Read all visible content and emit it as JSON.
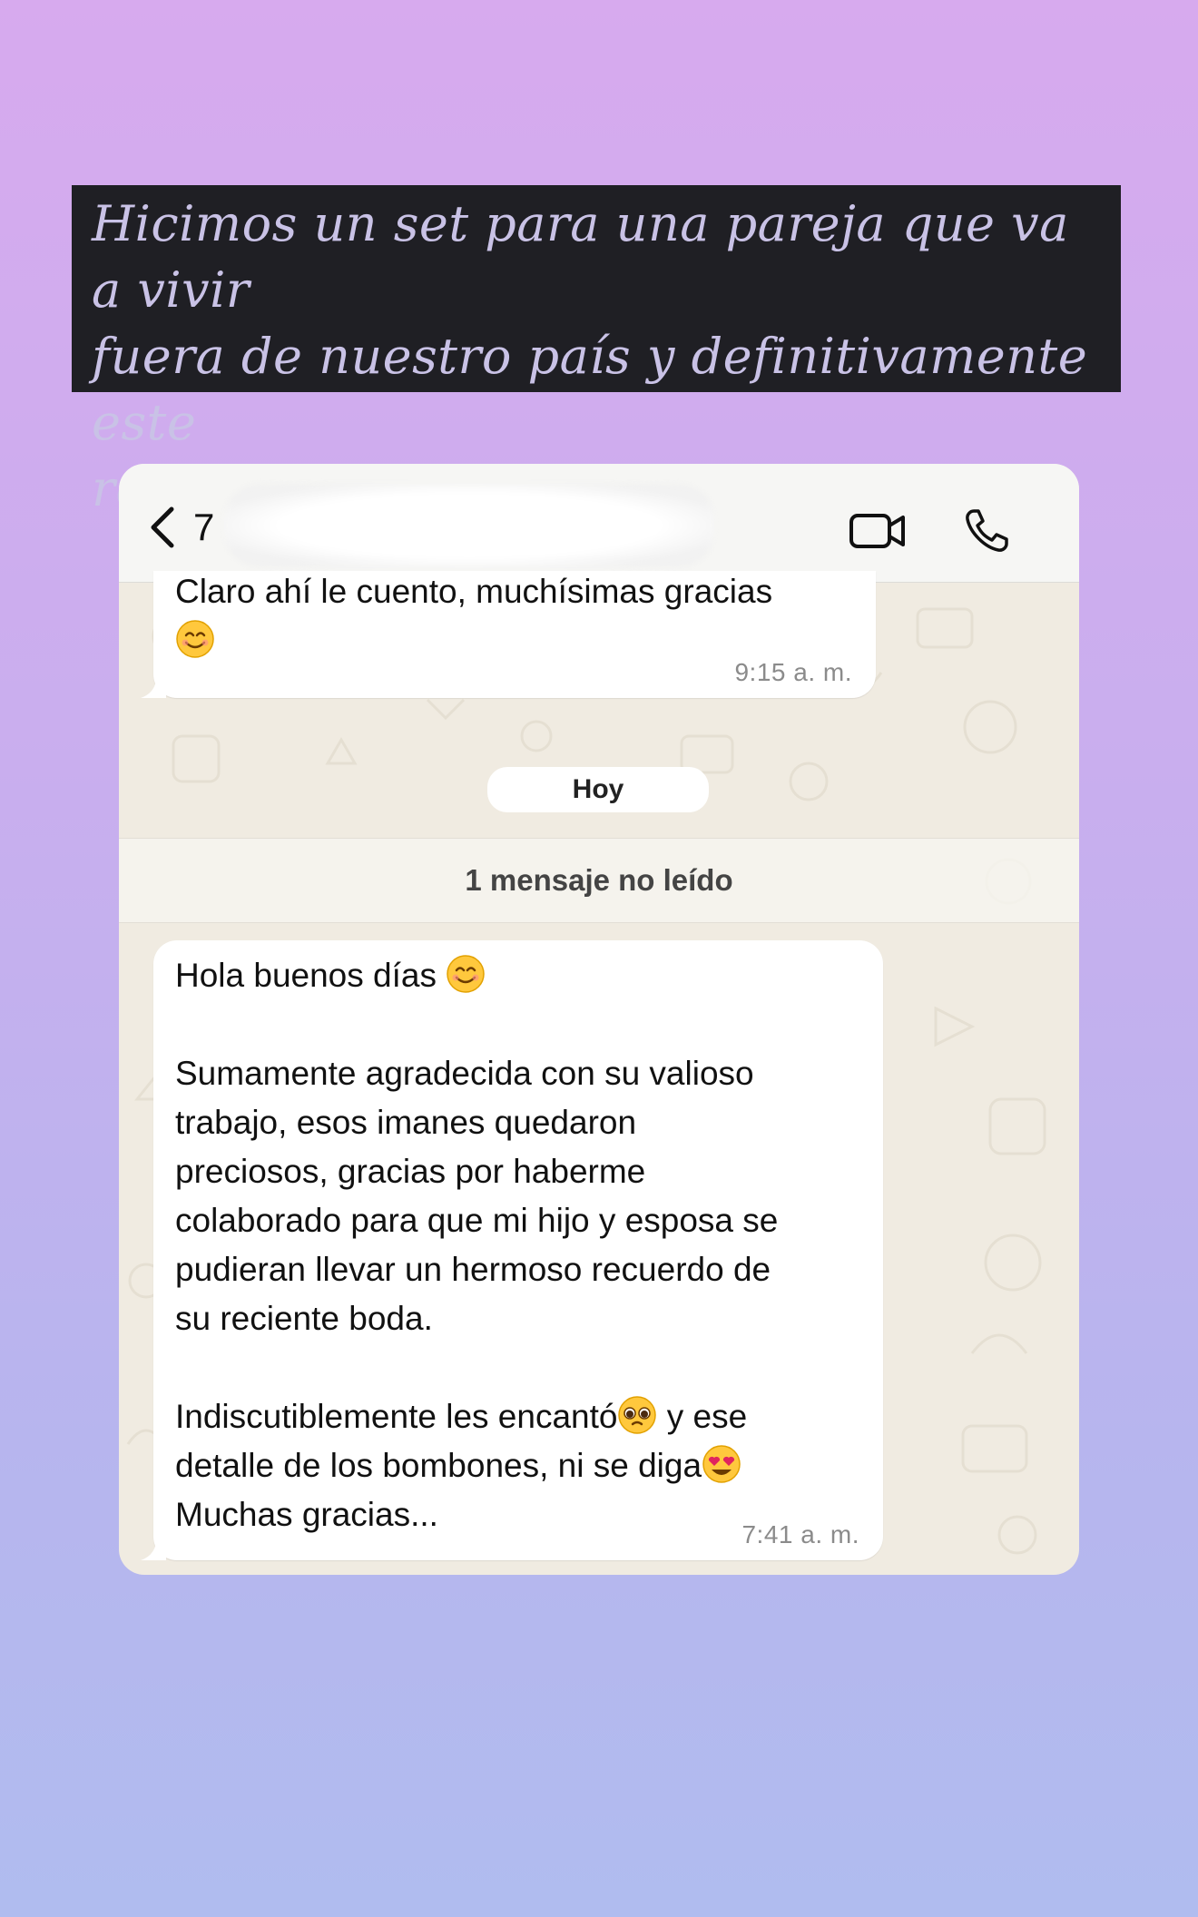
{
  "caption": {
    "text": "Hicimos un set para una pareja que va a vivir\nfuera de nuestro país y definitivamente este\nregalito les quedó perfecto!",
    "emoji": "❤️"
  },
  "chat": {
    "header": {
      "contact_name_visible": "7"
    },
    "messages": [
      {
        "text": "Claro ahí le cuento, muchísimas gracias",
        "emoji": "smiling-face",
        "time": "9:15 a. m."
      },
      {
        "text": "Hola buenos días",
        "emoji": "smiling-face",
        "body": "Sumamente agradecida con su valioso\ntrabajo, esos  imanes quedaron\npreciosos, gracias por haberme\ncolaborado para que mi hijo y esposa se\npudieran llevar un hermoso recuerdo de\nsu reciente boda.",
        "line3_a": "Indiscutiblemente les encantó",
        "line3_b": " y ese",
        "line4": "detalle de los bombones, ni se diga",
        "line5": "Muchas gracias...",
        "time": "7:41 a. m."
      }
    ],
    "day_separator": "Hoy",
    "unread_banner": "1 mensaje no leído"
  },
  "colors": {
    "caption_bg": "#1f1f24",
    "caption_text": "#c9c2e6",
    "chat_bg": "#f0ebe1",
    "bubble": "#ffffff"
  }
}
